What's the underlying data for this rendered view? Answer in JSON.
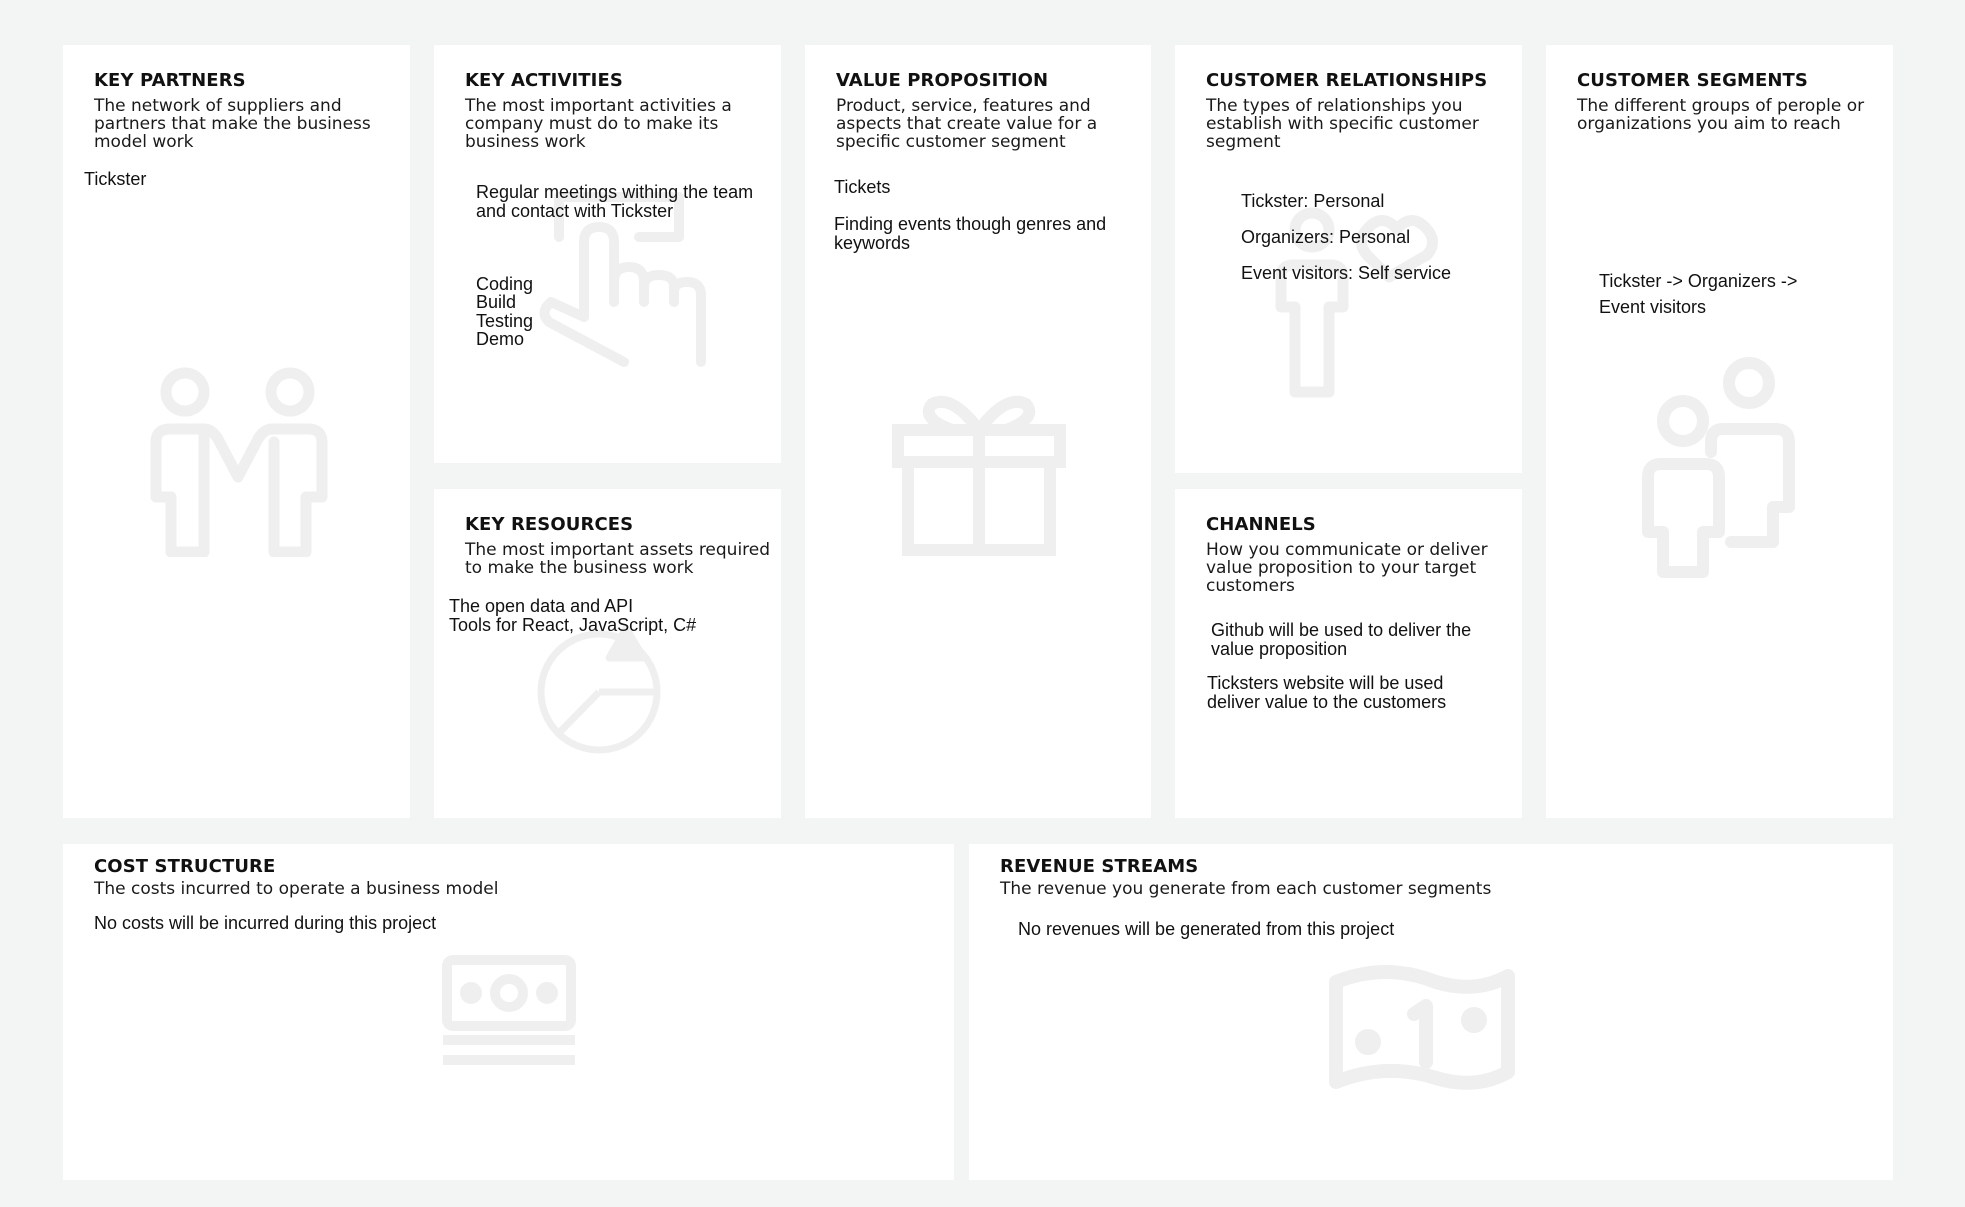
{
  "colors": {
    "background": "#f3f4f4",
    "card": "#ffffff",
    "icon": "#efefef",
    "text": "#111111"
  },
  "key_partners": {
    "title": "KEY PARTNERS",
    "description": "The network of suppliers and partners that make the business model work",
    "note": "Tickster",
    "icon": "partners-icon"
  },
  "key_activities": {
    "title": "KEY ACTIVITIES",
    "description": "The most important activities a company must do to make its business work",
    "notes": [
      "Regular meetings withing the team and contact with Tickster",
      "Coding\nBuild\nTesting\nDemo"
    ],
    "icon": "pointer-hand-icon"
  },
  "key_resources": {
    "title": "KEY RESOURCES",
    "description": "The most important assets required to make the business work",
    "note": "The open data and API\nTools for React, JavaScript, C#",
    "icon": "resources-shapes-icon"
  },
  "value_proposition": {
    "title": "VALUE PROPOSITION",
    "description": "Product, service, features and aspects that create value for a specific customer segment",
    "notes": [
      "Tickets",
      "Finding events though genres and keywords"
    ],
    "icon": "gift-icon"
  },
  "customer_relationships": {
    "title": "CUSTOMER RELATIONSHIPS",
    "description": "The types of relationships you establish with specific customer segment",
    "notes": [
      "Tickster: Personal",
      "Organizers: Personal",
      "Event visitors: Self service"
    ],
    "icon": "person-heart-icon"
  },
  "channels": {
    "title": "CHANNELS",
    "description": "How you communicate or deliver value proposition to your target customers",
    "notes": [
      "Github will be used to deliver the value proposition",
      "Ticksters website will be used deliver value to the customers"
    ]
  },
  "customer_segments": {
    "title": "CUSTOMER SEGMENTS",
    "description": "The different groups of perople or organizations you aim to reach",
    "note": "Tickster -> Organizers ->\nEvent visitors",
    "icon": "people-group-icon"
  },
  "cost_structure": {
    "title": "COST STRUCTURE",
    "description": "The costs incurred to operate a business model",
    "note": "No costs will be incurred during this project",
    "icon": "cash-stack-icon"
  },
  "revenue_streams": {
    "title": "REVENUE STREAMS",
    "description": "The revenue you generate from each customer segments",
    "note": "No revenues will be generated from this project",
    "icon": "banknote-icon"
  }
}
